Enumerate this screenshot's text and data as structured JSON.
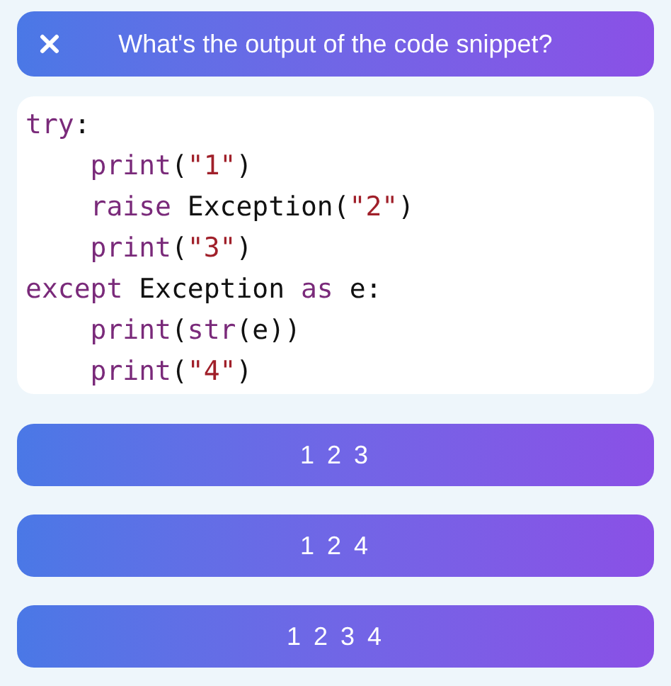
{
  "header": {
    "title": "What's the output of the code snippet?"
  },
  "code": {
    "lines": [
      [
        {
          "text": "try",
          "kind": "keyword"
        },
        {
          "text": ":",
          "kind": "plain"
        }
      ],
      [
        {
          "text": "    print",
          "kind": "keyword"
        },
        {
          "text": "(",
          "kind": "plain"
        },
        {
          "text": "\"1\"",
          "kind": "string"
        },
        {
          "text": ")",
          "kind": "plain"
        }
      ],
      [
        {
          "text": "    raise",
          "kind": "keyword"
        },
        {
          "text": " Exception(",
          "kind": "plain"
        },
        {
          "text": "\"2\"",
          "kind": "string"
        },
        {
          "text": ")",
          "kind": "plain"
        }
      ],
      [
        {
          "text": "    print",
          "kind": "keyword"
        },
        {
          "text": "(",
          "kind": "plain"
        },
        {
          "text": "\"3\"",
          "kind": "string"
        },
        {
          "text": ")",
          "kind": "plain"
        }
      ],
      [
        {
          "text": "except",
          "kind": "keyword"
        },
        {
          "text": " Exception ",
          "kind": "plain"
        },
        {
          "text": "as",
          "kind": "keyword"
        },
        {
          "text": " e:",
          "kind": "plain"
        }
      ],
      [
        {
          "text": "    print",
          "kind": "keyword"
        },
        {
          "text": "(",
          "kind": "plain"
        },
        {
          "text": "str",
          "kind": "keyword"
        },
        {
          "text": "(e))",
          "kind": "plain"
        }
      ],
      [
        {
          "text": "    print",
          "kind": "keyword"
        },
        {
          "text": "(",
          "kind": "plain"
        },
        {
          "text": "\"4\"",
          "kind": "string"
        },
        {
          "text": ")",
          "kind": "plain"
        }
      ]
    ]
  },
  "answers": [
    "1 2 3",
    "1 2 4",
    "1 2 3 4"
  ]
}
